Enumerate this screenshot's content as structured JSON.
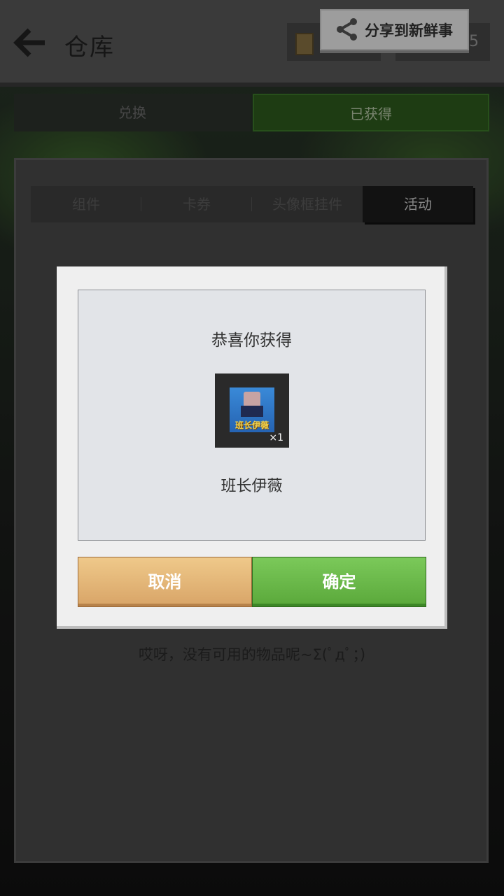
{
  "header": {
    "title": "仓库",
    "resource_count": "5",
    "share_label": "分享到新鲜事"
  },
  "main_tabs": [
    {
      "label": "兑换",
      "active": false
    },
    {
      "label": "已获得",
      "active": true
    }
  ],
  "sub_tabs": [
    {
      "label": "组件"
    },
    {
      "label": "卡券"
    },
    {
      "label": "头像框挂件"
    },
    {
      "label": "活动"
    }
  ],
  "empty_message": "哎呀，没有可用的物品呢~Σ(ﾟдﾟ；)",
  "dialog": {
    "title": "恭喜你获得",
    "item_name": "班长伊薇",
    "item_image_caption": "班长伊薇",
    "item_quantity": "×1",
    "cancel_label": "取消",
    "confirm_label": "确定"
  },
  "colors": {
    "confirm": "#5aa83a",
    "cancel": "#d8a467",
    "header": "#5a5a5a"
  },
  "icons": {
    "back": "back-arrow-icon",
    "share": "share-icon",
    "resource": "book-icon"
  }
}
